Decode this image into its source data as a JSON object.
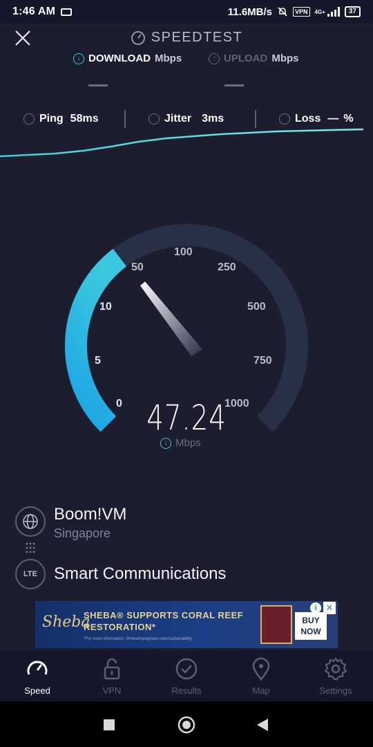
{
  "status_bar": {
    "time": "1:46 AM",
    "net_speed": "11.6MB/s",
    "vpn": "VPN",
    "network": "4G+",
    "battery": "37"
  },
  "header": {
    "title": "SPEEDTEST",
    "download_label": "DOWNLOAD",
    "upload_label": "UPLOAD",
    "unit": "Mbps"
  },
  "stats": {
    "ping_label": "Ping",
    "ping_value": "58ms",
    "jitter_label": "Jitter",
    "jitter_value": "3ms",
    "loss_label": "Loss",
    "loss_value": "—",
    "loss_unit": "%"
  },
  "gauge": {
    "ticks": [
      "0",
      "5",
      "10",
      "50",
      "100",
      "250",
      "500",
      "750",
      "1000"
    ],
    "speed": "47.24",
    "unit": "Mbps",
    "accent_color": "#2bb8e6",
    "track_color": "#283048"
  },
  "server": {
    "name": "Boom!VM",
    "location": "Singapore",
    "isp_badge": "LTE",
    "isp": "Smart Communications"
  },
  "ad": {
    "brand": "Sheba",
    "headline": "SHEBA® SUPPORTS CORAL REEF RESTORATION*",
    "fine_print": "*For more information: Shebahopegrows.com/sustainability",
    "buy_now": "BUY NOW",
    "info": "i",
    "close": "✕"
  },
  "bottom_nav": [
    {
      "label": "Speed",
      "icon": "speedometer-icon",
      "active": true
    },
    {
      "label": "VPN",
      "icon": "lock-icon",
      "active": false
    },
    {
      "label": "Results",
      "icon": "check-circle-icon",
      "active": false
    },
    {
      "label": "Map",
      "icon": "map-pin-icon",
      "active": false
    },
    {
      "label": "Settings",
      "icon": "gear-icon",
      "active": false
    }
  ]
}
